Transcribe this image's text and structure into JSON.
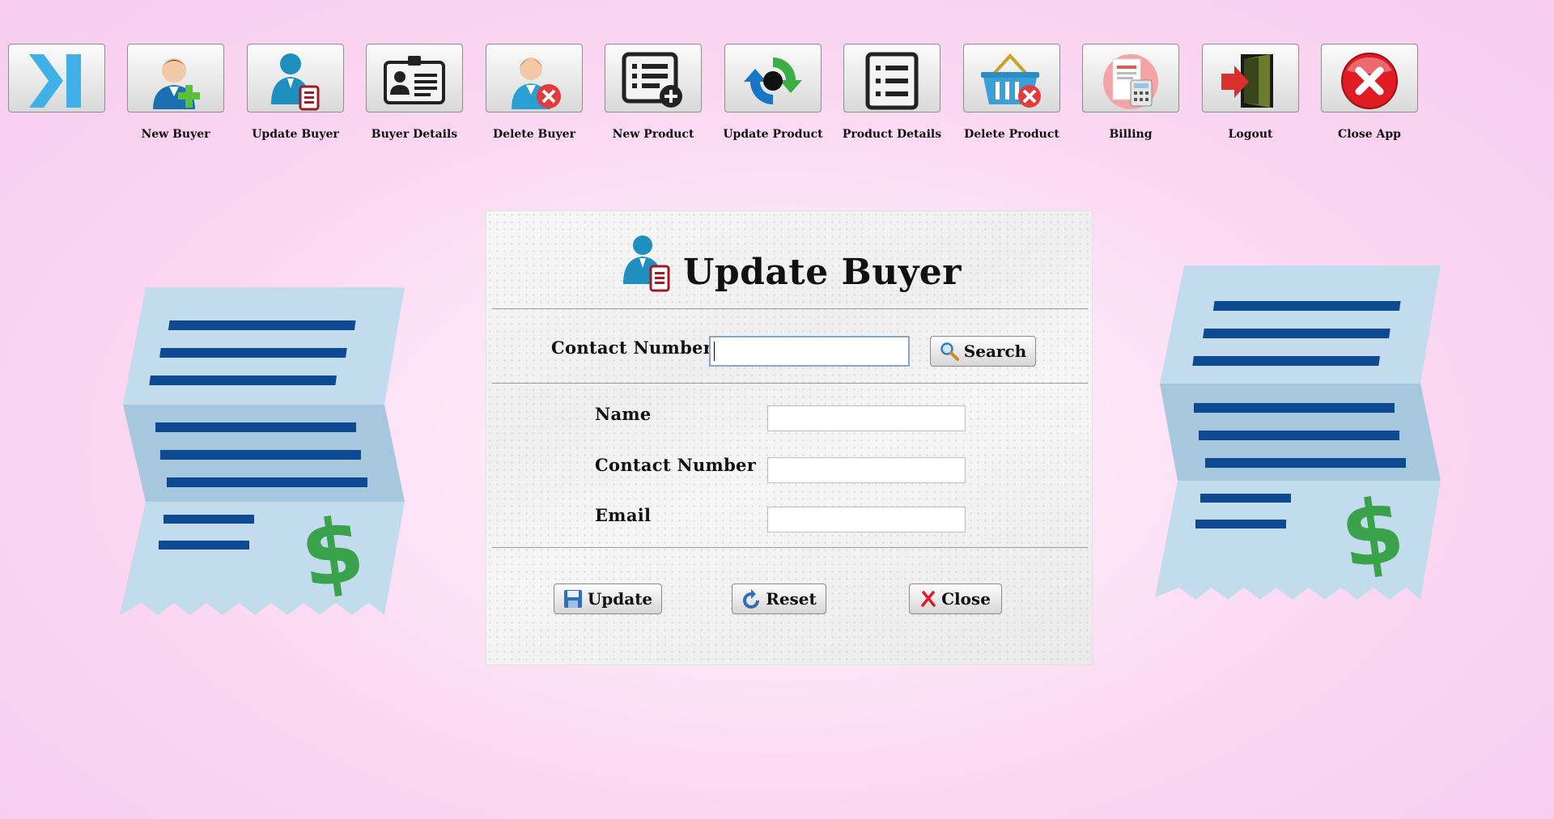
{
  "toolbar": {
    "items": [
      {
        "name": "collapse",
        "label": "",
        "icon": "chevron-bar-icon"
      },
      {
        "name": "new-buyer",
        "label": "New Buyer",
        "icon": "person-add-icon"
      },
      {
        "name": "update-buyer",
        "label": "Update Buyer",
        "icon": "person-edit-icon"
      },
      {
        "name": "buyer-details",
        "label": "Buyer Details",
        "icon": "id-card-icon"
      },
      {
        "name": "delete-buyer",
        "label": "Delete Buyer",
        "icon": "person-remove-icon"
      },
      {
        "name": "new-product",
        "label": "New Product",
        "icon": "list-add-icon"
      },
      {
        "name": "update-product",
        "label": "Update Product",
        "icon": "refresh-icon"
      },
      {
        "name": "product-details",
        "label": "Product Details",
        "icon": "list-icon"
      },
      {
        "name": "delete-product",
        "label": "Delete Product",
        "icon": "basket-remove-icon"
      },
      {
        "name": "billing",
        "label": "Billing",
        "icon": "calculator-icon"
      },
      {
        "name": "logout",
        "label": "Logout",
        "icon": "door-exit-icon"
      },
      {
        "name": "close-app",
        "label": "Close App",
        "icon": "close-circle-icon"
      }
    ]
  },
  "form": {
    "title": "Update Buyer",
    "search": {
      "label": "Contact Number",
      "value": "",
      "button": "Search"
    },
    "fields": {
      "name": {
        "label": "Name",
        "value": ""
      },
      "contact": {
        "label": "Contact Number",
        "value": ""
      },
      "email": {
        "label": "Email",
        "value": ""
      }
    },
    "buttons": {
      "update": "Update",
      "reset": "Reset",
      "close": "Close"
    }
  },
  "colors": {
    "background": "#fad6f1",
    "receipt_paper": "#bcd9ec",
    "receipt_lines": "#0d4a91",
    "dollar": "#3aa24a",
    "close_red": "#e01b24"
  }
}
